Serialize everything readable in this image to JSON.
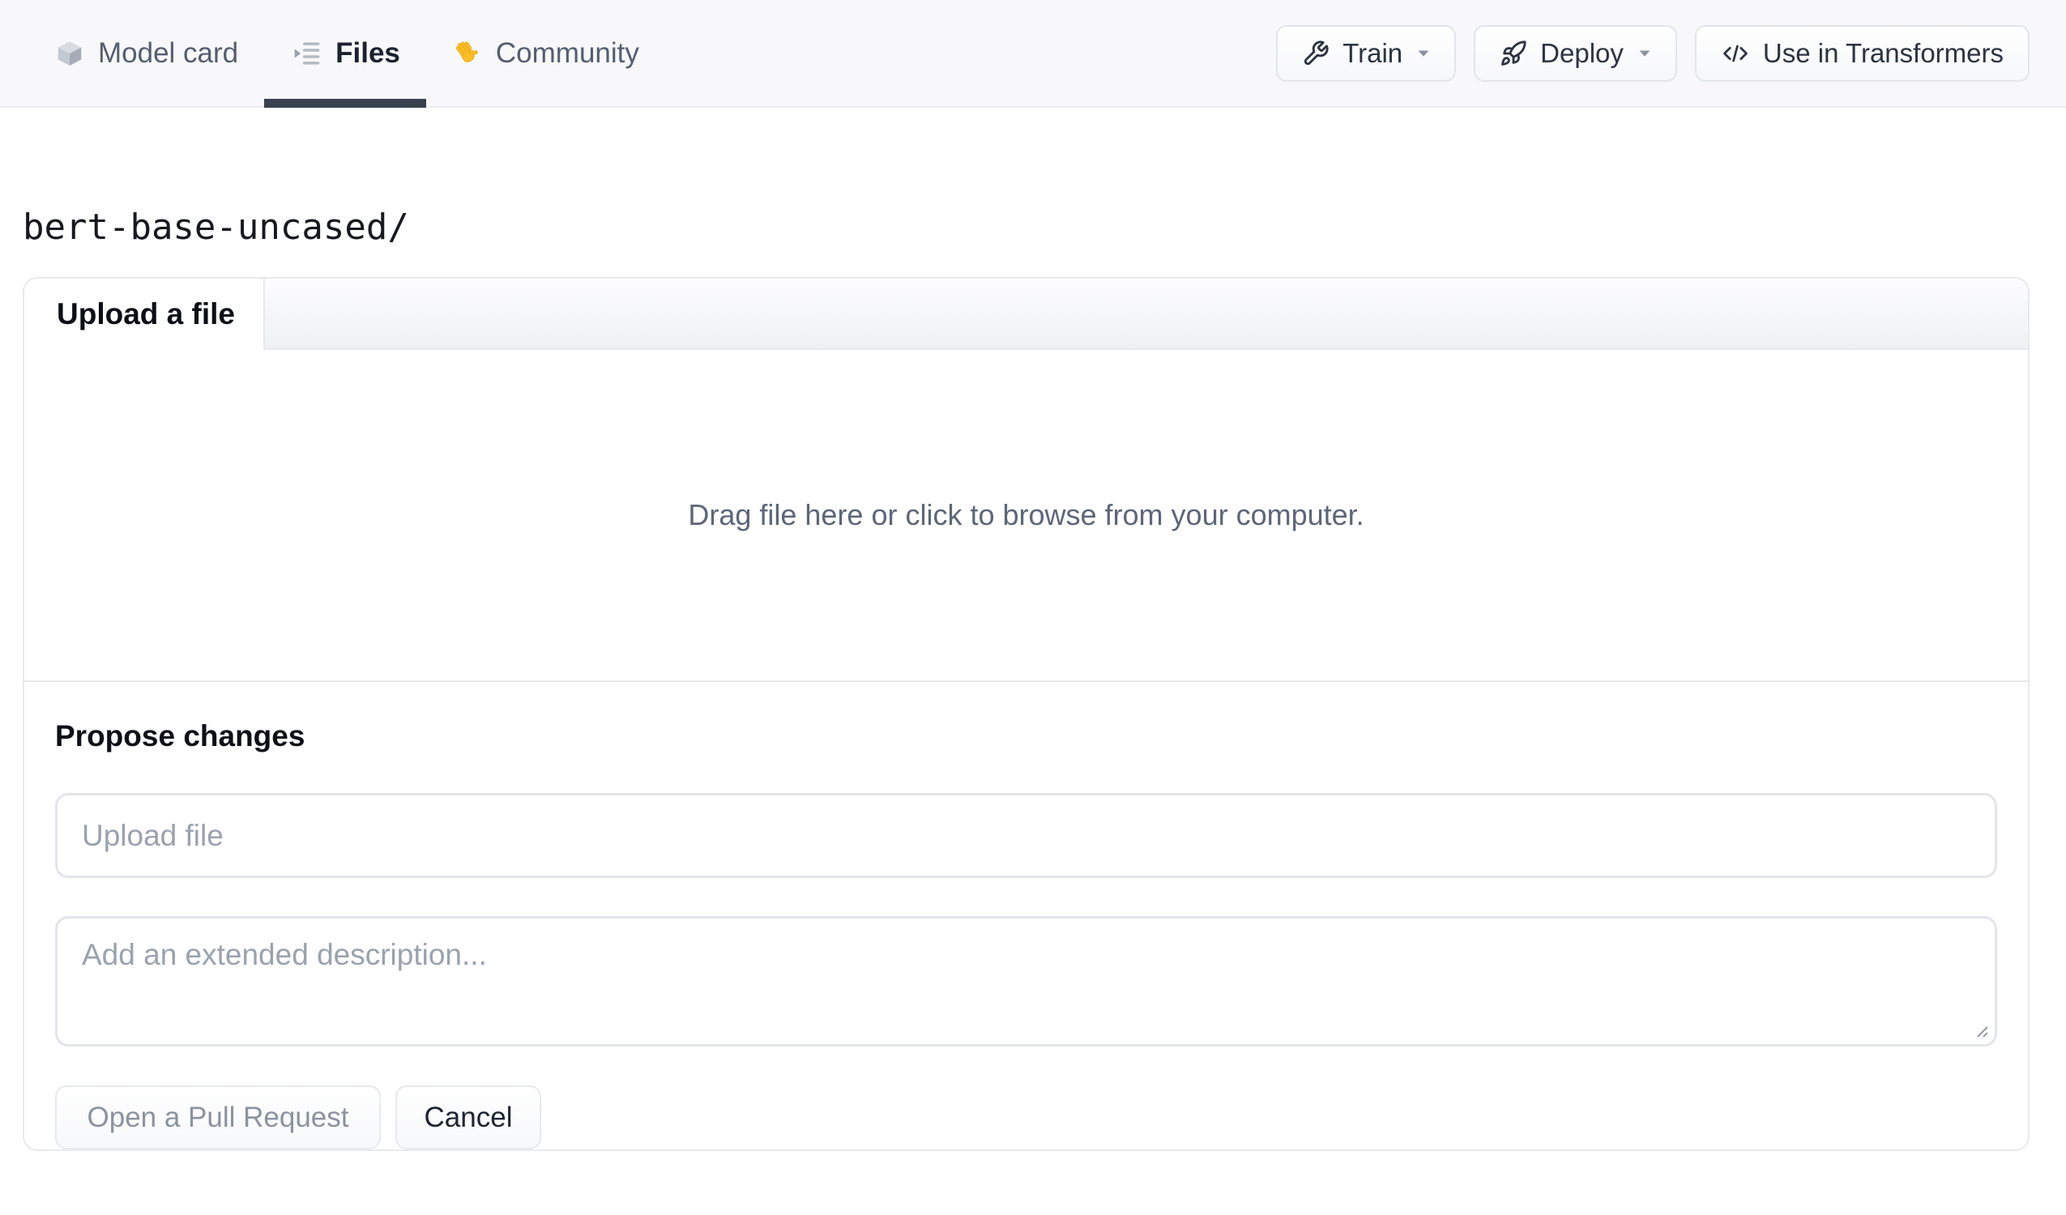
{
  "nav": {
    "tabs": [
      {
        "label": "Model card",
        "icon": "cube-icon",
        "active": false
      },
      {
        "label": "Files",
        "icon": "file-versions-icon",
        "active": true
      },
      {
        "label": "Community",
        "icon": "waving-hand-icon",
        "active": false
      }
    ],
    "actions": [
      {
        "label": "Train",
        "icon": "wrench-icon",
        "has_caret": true
      },
      {
        "label": "Deploy",
        "icon": "rocket-icon",
        "has_caret": true
      },
      {
        "label": "Use in Transformers",
        "icon": "code-icon",
        "has_caret": false
      }
    ]
  },
  "breadcrumb": {
    "repo_path": "bert-base-uncased/"
  },
  "upload_panel": {
    "tab_label": "Upload a file",
    "dropzone_hint": "Drag file here or click to browse from your computer.",
    "propose_changes": {
      "heading": "Propose changes",
      "file_placeholder": "Upload file",
      "description_placeholder": "Add an extended description...",
      "submit_label": "Open a Pull Request",
      "cancel_label": "Cancel"
    }
  },
  "icons": {
    "cube-icon": "isometric gray cube",
    "file-versions-icon": "chevron-right with list lines",
    "waving-hand-icon": "👋",
    "wrench-icon": "outline wrench",
    "rocket-icon": "outline rocket",
    "code-icon": "</>",
    "caret-down-icon": "▾",
    "resize-handle-icon": "diagonal grip lines"
  },
  "colors": {
    "nav_bg": "#f8f8fa",
    "nav_border": "#e9ebee",
    "active_tab_underline": "#39414f",
    "panel_border": "#e8e9ed",
    "dark_text": "#1b2231",
    "muted_text": "#5d6678",
    "placeholder_text": "#9aa2b0",
    "disabled_text": "#8b93a1",
    "hand_emoji": "#fbbf24"
  }
}
